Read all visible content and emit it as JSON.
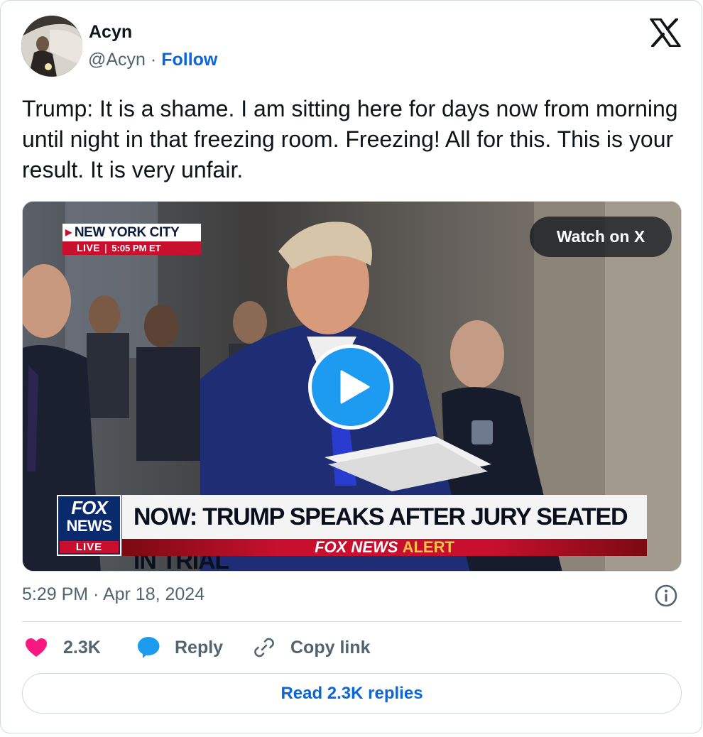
{
  "author": {
    "name": "Acyn",
    "handle": "@Acyn",
    "separator": "·",
    "follow_label": "Follow"
  },
  "brand_icon": "x-logo-icon",
  "tweet": {
    "text": "Trump: It is a shame. I am sitting here for days now from morning until night in that freezing room. Freezing! All for this. This is your result. It is very unfair."
  },
  "media": {
    "watch_label": "Watch on X",
    "play_icon": "play-icon",
    "overlay": {
      "location": "NEW YORK CITY",
      "live": "LIVE",
      "divider": "|",
      "time": "5:05 PM ET",
      "logo_fox": "FOX",
      "logo_news": "NEWS",
      "logo_live": "LIVE",
      "headline": "NOW: TRUMP SPEAKS AFTER JURY SEATED IN TRIAL",
      "alert_brand": "FOX NEWS",
      "alert_word": "ALERT"
    }
  },
  "timestamp": "5:29 PM · Apr 18, 2024",
  "actions": {
    "like_count": "2.3K",
    "reply_label": "Reply",
    "copy_label": "Copy link"
  },
  "read_replies_label": "Read 2.3K replies",
  "colors": {
    "accent": "#0b66d8",
    "like": "#f91880",
    "reply": "#1d9bf0",
    "muted": "#536471",
    "border": "#cfd9de"
  }
}
